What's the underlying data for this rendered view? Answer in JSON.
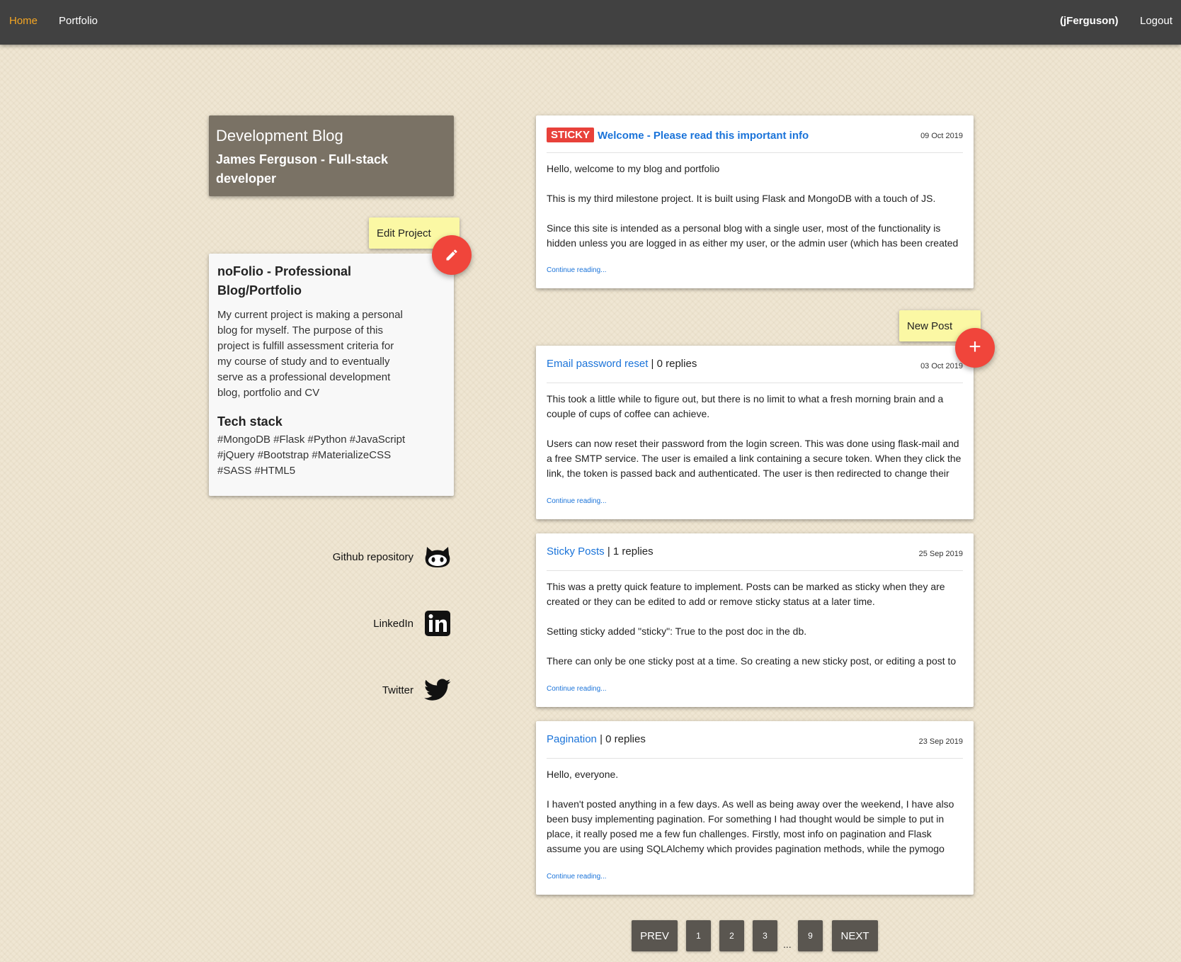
{
  "nav": {
    "home": "Home",
    "portfolio": "Portfolio",
    "user": "(jFerguson)",
    "logout": "Logout"
  },
  "header": {
    "title": "Development Blog",
    "subtitle": "James Ferguson - Full-stack developer"
  },
  "edit_project": {
    "label": "Edit Project",
    "icon": "pencil-icon"
  },
  "project": {
    "title": "noFolio - Professional Blog/Portfolio",
    "description": "My current project is making a personal blog for myself. The purpose of this project is fulfill assessment criteria for my course of study and to eventually serve as a professional development blog, portfolio and CV",
    "tech_title": "Tech stack",
    "tech_list": "#MongoDB #Flask #Python #JavaScript #jQuery #Bootstrap #MaterializeCSS #SASS #HTML5"
  },
  "social": {
    "github": "Github repository",
    "linkedin": "LinkedIn",
    "twitter": "Twitter"
  },
  "new_post": {
    "label": "New Post",
    "icon": "plus-icon"
  },
  "posts": [
    {
      "badge": "STICKY",
      "title": "Welcome - Please read this important info",
      "replies": "",
      "date": "09 Oct 2019",
      "paragraphs": [
        "Hello, welcome to my blog and portfolio",
        "This is my third milestone project. It is built using Flask and MongoDB with a touch of JS.",
        "Since this site is intended as a personal blog with a single user, most of the functionality is hidden unless you are logged in as either my user, or the admin user (which has been created"
      ],
      "continue": "Continue reading..."
    },
    {
      "title": "Email password reset",
      "replies": " | 0 replies",
      "date": "03 Oct 2019",
      "paragraphs": [
        "This took a little while to figure out, but there is no limit to what a fresh morning brain and a couple of cups of coffee can achieve.",
        "Users can now reset their password from the login screen. This was done using flask-mail and a free SMTP service. The user is emailed a link containing a secure token. When they click the link, the token is passed back and authenticated. The user is then redirected to change their"
      ],
      "continue": "Continue reading..."
    },
    {
      "title": "Sticky Posts",
      "replies": " | 1 replies",
      "date": "25 Sep 2019",
      "paragraphs": [
        "This was a pretty quick feature to implement. Posts can be marked as sticky when they are created or they can be edited to add or remove sticky status at a later time.",
        "Setting sticky added \"sticky\": True to the post doc in the db.",
        "There can only be one sticky post at a time. So creating a new sticky post, or editing a post to"
      ],
      "continue": "Continue reading..."
    },
    {
      "title": "Pagination",
      "replies": " | 0 replies",
      "date": "23 Sep 2019",
      "paragraphs": [
        "Hello, everyone.",
        "I haven't posted anything in a few days. As well as being away over the weekend, I have also been busy implementing pagination. For something I had thought would be simple to put in place, it really posed me a few fun challenges. Firstly, most info on pagination and Flask assume you are using SQLAlchemy which provides pagination methods, while the pymogo"
      ],
      "continue": "Continue reading..."
    }
  ],
  "pagination": {
    "prev": "PREV",
    "pages": [
      "1",
      "2",
      "3"
    ],
    "ellipsis": "...",
    "last": "9",
    "next": "NEXT"
  }
}
